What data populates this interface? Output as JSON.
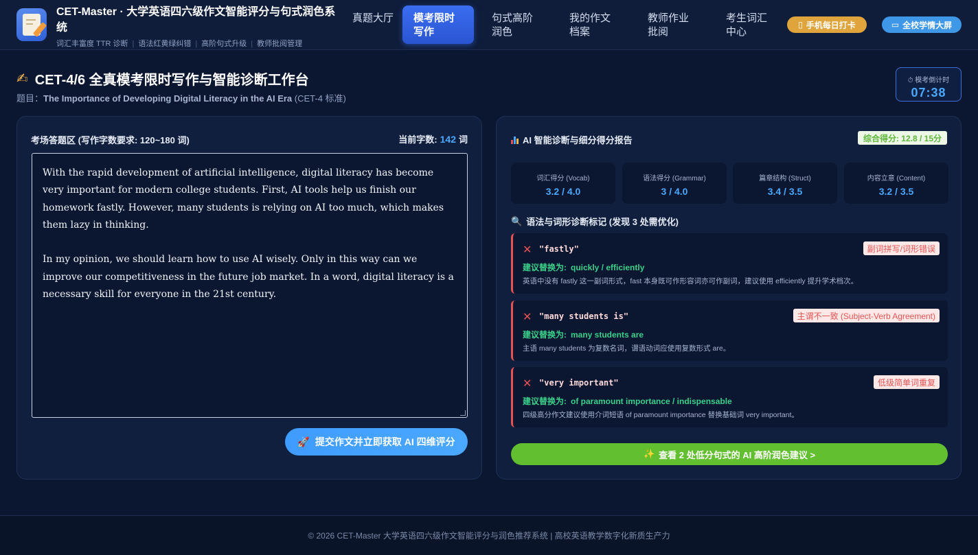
{
  "header": {
    "title": "CET-Master · 大学英语四六级作文智能评分与句式润色系统",
    "subtitle_items": [
      "词汇丰富度 TTR 诊断",
      "语法红黄绿纠错",
      "高阶句式升级",
      "教师批阅管理"
    ],
    "nav": [
      {
        "label": "真题大厅",
        "active": false
      },
      {
        "label": "模考限时写作",
        "active": true
      },
      {
        "label": "句式高阶润色",
        "active": false
      },
      {
        "label": "我的作文档案",
        "active": false
      },
      {
        "label": "教师作业批阅",
        "active": false
      },
      {
        "label": "考生词汇中心",
        "active": false
      }
    ],
    "checkin_label": "手机每日打卡",
    "screen_label": "全校学情大屏"
  },
  "page": {
    "title": "CET-4/6 全真模考限时写作与智能诊断工作台",
    "topic_prefix": "题目：",
    "topic": "The Importance of Developing Digital Literacy in the AI Era",
    "topic_suffix": " (CET-4 标准)",
    "timer_label": "模考倒计时",
    "timer_value": "07:38"
  },
  "editor": {
    "title": "考场答题区 (写作字数要求: 120~180 词)",
    "count_label": "当前字数:",
    "count_value": "142",
    "count_unit": "词",
    "paragraphs": [
      "With the rapid development of artificial intelligence, digital literacy has become very important for modern college students. First, AI tools help us finish our homework fastly. However, many students is relying on AI too much, which makes them lazy in thinking.",
      "In my opinion, we should learn how to use AI wisely. Only in this way can we improve our competitiveness in the future job market. In a word, digital literacy is a necessary skill for everyone in the 21st century."
    ],
    "submit_label": "提交作文并立即获取 AI 四维评分"
  },
  "report": {
    "title": "AI 智能诊断与细分得分报告",
    "total_score": "综合得分: 12.8 / 15分",
    "scores": [
      {
        "label": "词汇得分 (Vocab)",
        "value": "3.2 / 4.0"
      },
      {
        "label": "语法得分 (Grammar)",
        "value": "3 / 4.0"
      },
      {
        "label": "篇章结构 (Struct)",
        "value": "3.4 / 3.5"
      },
      {
        "label": "内容立意 (Content)",
        "value": "3.2 / 3.5"
      }
    ],
    "diag_title": "语法与词形诊断标记 (发现 3 处需优化)",
    "suggest_label": "建议替换为:",
    "issues": [
      {
        "phrase": "\"fastly\"",
        "tag": "副词拼写/词形错误",
        "suggestion": "quickly / efficiently",
        "explain": "英语中没有 fastly 这一副词形式，fast 本身既可作形容词亦可作副词，建议使用 efficiently 提升学术档次。"
      },
      {
        "phrase": "\"many students is\"",
        "tag": "主谓不一致 (Subject-Verb Agreement)",
        "suggestion": "many students are",
        "explain": "主语 many students 为复数名词，谓语动词应使用复数形式 are。"
      },
      {
        "phrase": "\"very important\"",
        "tag": "低级简单词重复",
        "suggestion": "of paramount importance / indispensable",
        "explain": "四级高分作文建议使用介词短语 of paramount importance 替换基础词 very important。"
      }
    ],
    "polish_label": "查看 2 处低分句式的 AI 高阶润色建议 >"
  },
  "footer": {
    "text": "© 2026 CET-Master 大学英语四六级作文智能评分与润色推荐系统 | 高校英语教学数字化新质生产力"
  }
}
